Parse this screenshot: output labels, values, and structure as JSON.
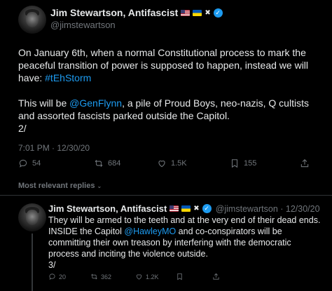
{
  "tweet": {
    "display_name": "Jim Stewartson, Antifascist",
    "name_emojis": [
      "us-flag",
      "ukraine-flag",
      "x-flag"
    ],
    "handle": "@jimstewartson",
    "text_p1_before": "On January 6th, when a normal Constitutional process to mark the peaceful transition of power is supposed to happen, instead we will have: ",
    "hashtag": "#tEhStorm",
    "text_p2_before": "This will be ",
    "mention": "@GenFlynn",
    "text_p2_after": ", a pile of Proud Boys, neo-nazis, Q cultists and assorted fascists parked outside the Capitol.",
    "thread_marker": "2/",
    "timestamp": "7:01 PM · 12/30/20",
    "actions": {
      "replies": "54",
      "retweets": "684",
      "likes": "1.5K",
      "bookmarks": "155"
    }
  },
  "sort_label": "Most relevant replies",
  "reply": {
    "display_name": "Jim Stewartson, Antifascist",
    "handle_date": "@jimstewartson · 12/30/20",
    "text_before": "They will be armed to the teeth and at the very end of their dead ends. INSIDE the Capitol ",
    "mention": "@HawleyMO",
    "text_after": " and co-conspirators will be committing their own treason by interfering with the democratic process and inciting the violence outside.",
    "thread_marker": "3/",
    "actions": {
      "replies": "20",
      "retweets": "362",
      "likes": "1.2K"
    }
  },
  "colors": {
    "background": "#000000",
    "text": "#e7e9ea",
    "secondary": "#71767b",
    "link": "#1d9bf0",
    "verified": "#1d9bf0"
  }
}
